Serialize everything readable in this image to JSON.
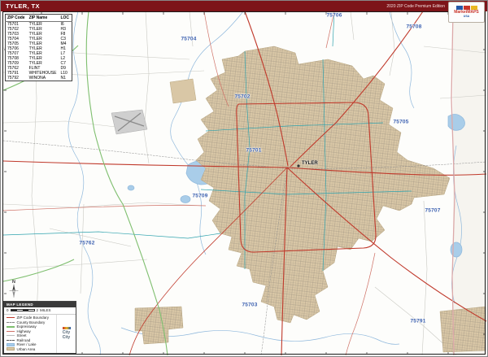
{
  "header": {
    "title": "TYLER, TX",
    "edition": "2020 ZIP Code Premium Edition"
  },
  "brand": {
    "name": "MarketMAPS",
    "tagline": "USA"
  },
  "zip_table": {
    "columns": [
      "ZIP Code",
      "ZIP Name",
      "LOC"
    ],
    "rows": [
      {
        "zip": "75701",
        "name": "TYLER",
        "loc": "I6"
      },
      {
        "zip": "75702",
        "name": "TYLER",
        "loc": "H3"
      },
      {
        "zip": "75703",
        "name": "TYLER",
        "loc": "F8"
      },
      {
        "zip": "75704",
        "name": "TYLER",
        "loc": "C3"
      },
      {
        "zip": "75705",
        "name": "TYLER",
        "loc": "M4"
      },
      {
        "zip": "75706",
        "name": "TYLER",
        "loc": "H1"
      },
      {
        "zip": "75707",
        "name": "TYLER",
        "loc": "L7"
      },
      {
        "zip": "75708",
        "name": "TYLER",
        "loc": "L2"
      },
      {
        "zip": "75709",
        "name": "TYLER",
        "loc": "C7"
      },
      {
        "zip": "75762",
        "name": "FLINT",
        "loc": "D9"
      },
      {
        "zip": "75791",
        "name": "WHITEHOUSE",
        "loc": "L10"
      },
      {
        "zip": "75792",
        "name": "WINONA",
        "loc": "N1"
      }
    ]
  },
  "map": {
    "city_label": "TYLER",
    "zip_labels": [
      {
        "zip": "75706"
      },
      {
        "zip": "75708"
      },
      {
        "zip": "75704"
      },
      {
        "zip": "75702"
      },
      {
        "zip": "75705"
      },
      {
        "zip": "75701"
      },
      {
        "zip": "75709"
      },
      {
        "zip": "75707"
      },
      {
        "zip": "75762"
      },
      {
        "zip": "75703"
      },
      {
        "zip": "75791"
      }
    ]
  },
  "legend": {
    "title": "MAP LEGEND",
    "scale": {
      "label": "MILES",
      "ticks": [
        "0",
        "1",
        "2"
      ]
    },
    "items": [
      {
        "label": "ZIP Code Boundary"
      },
      {
        "label": "County Boundary"
      },
      {
        "label": "Expressway"
      },
      {
        "label": "Highway"
      },
      {
        "label": "Street"
      },
      {
        "label": "Railroad"
      },
      {
        "label": "River / Lake"
      },
      {
        "label": "Urban Area"
      }
    ],
    "side_labels": [
      "City",
      "City"
    ]
  },
  "compass": {
    "north": "N"
  },
  "colors": {
    "header_bg": "#7d1419",
    "urban_area": "#d9c7a6",
    "water": "#a9cde9",
    "zip_label_blue": "#3a5fae",
    "zip_boundary_teal": "#2fa3ae",
    "highway_red": "#c0392b",
    "expressway_green": "#7fbf6f"
  }
}
